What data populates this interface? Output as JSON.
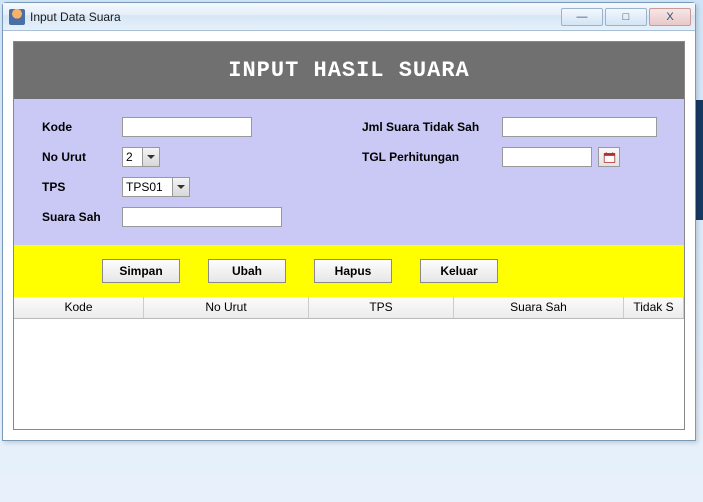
{
  "window": {
    "title": "Input Data Suara",
    "min": "—",
    "max": "□",
    "close": "X"
  },
  "header": {
    "title": "INPUT HASIL SUARA"
  },
  "form": {
    "kode": {
      "label": "Kode",
      "value": ""
    },
    "nourut": {
      "label": "No Urut",
      "value": "2"
    },
    "tps": {
      "label": "TPS",
      "value": "TPS01"
    },
    "suarasah": {
      "label": "Suara Sah",
      "value": ""
    },
    "tidaksah": {
      "label": "Jml Suara Tidak Sah",
      "value": ""
    },
    "tgl": {
      "label": "TGL Perhitungan",
      "value": ""
    }
  },
  "buttons": {
    "simpan": "Simpan",
    "ubah": "Ubah",
    "hapus": "Hapus",
    "keluar": "Keluar"
  },
  "table": {
    "columns": [
      "Kode",
      "No Urut",
      "TPS",
      "Suara Sah",
      "Tidak S"
    ]
  }
}
